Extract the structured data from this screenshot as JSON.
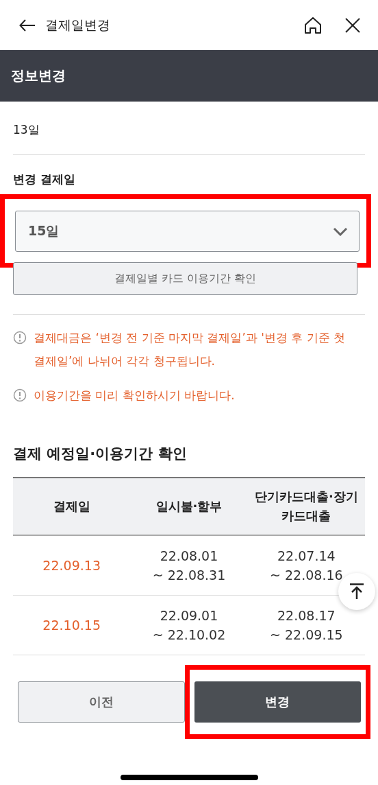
{
  "nav": {
    "title": "결제일변경"
  },
  "header": {
    "title": "정보변경"
  },
  "current": {
    "value": "13일"
  },
  "change": {
    "label": "변경 결제일",
    "select": {
      "value": "15일",
      "highlighted": true
    },
    "period_button": "결제일별 카드 이용기간 확인"
  },
  "notices": [
    "결제대금은 ‘변경 전 기준 마지막 결제일’과 '변경 후 기준 첫 결제일’에 나뉘어 각각 청구됩니다.",
    "이용기간을 미리 확인하시기 바랍니다."
  ],
  "schedule": {
    "title": "결제 예정일·이용기간 확인",
    "columns": [
      "결제일",
      "일시불·할부",
      "단기카드대출·장기카드대출"
    ],
    "rows": [
      {
        "date": "22.09.13",
        "installment": [
          "22.08.01",
          "~ 22.08.31"
        ],
        "loan": [
          "22.07.14",
          "~ 22.08.16"
        ]
      },
      {
        "date": "22.10.15",
        "installment": [
          "22.09.01",
          "~ 22.10.02"
        ],
        "loan": [
          "22.08.17",
          "~ 22.09.15"
        ]
      }
    ]
  },
  "buttons": [
    {
      "label": "이전",
      "kind": "secondary",
      "highlighted": false
    },
    {
      "label": "변경",
      "kind": "primary",
      "highlighted": true
    }
  ]
}
